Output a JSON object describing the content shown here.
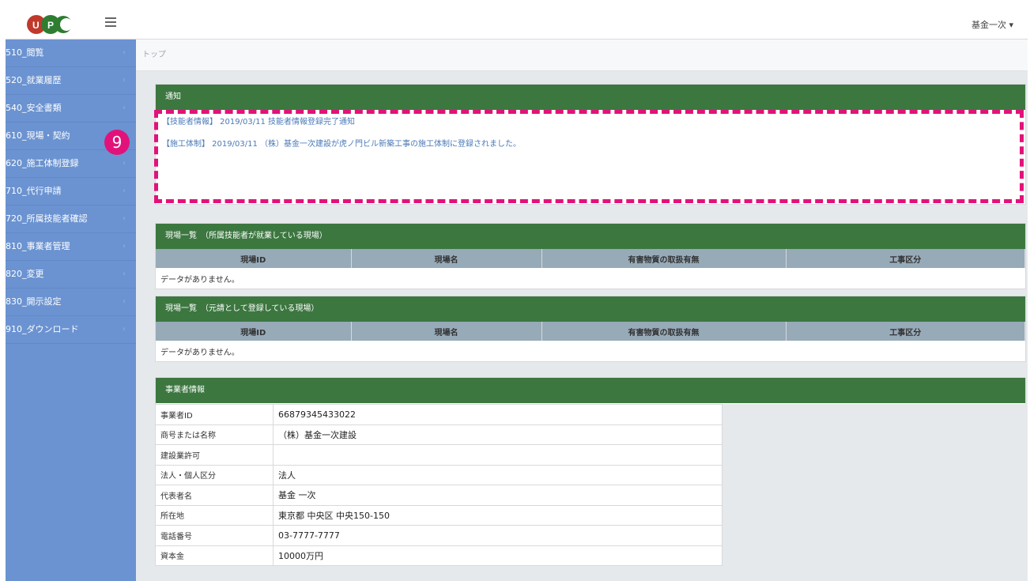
{
  "header": {
    "logo_text": "UCP",
    "user_menu": "基金一次 ▾"
  },
  "sidebar": {
    "items": [
      {
        "label": "510_閲覧"
      },
      {
        "label": "520_就業履歴"
      },
      {
        "label": "540_安全書類"
      },
      {
        "label": "610_現場・契約"
      },
      {
        "label": "620_施工体制登録"
      },
      {
        "label": "710_代行申請"
      },
      {
        "label": "720_所属技能者確認"
      },
      {
        "label": "810_事業者管理"
      },
      {
        "label": "820_変更"
      },
      {
        "label": "830_開示設定"
      },
      {
        "label": "910_ダウンロード"
      }
    ],
    "chevron": "‹"
  },
  "annotation": {
    "number": "9",
    "color": "#e2127a"
  },
  "breadcrumb": "トップ",
  "notice": {
    "title": "通知",
    "items": [
      "【技能者情報】 2019/03/11 技能者情報登録完了通知",
      "【施工体制】 2019/03/11 （株）基金一次建設が虎ノ門ビル新築工事の施工体制に登録されました。"
    ]
  },
  "sites_worked": {
    "title": "現場一覧　（所属技能者が就業している現場）",
    "columns": [
      "現場ID",
      "現場名",
      "有害物質の取扱有無",
      "工事区分"
    ],
    "empty": "データがありません。"
  },
  "sites_prime": {
    "title": "現場一覧　（元請として登録している現場）",
    "columns": [
      "現場ID",
      "現場名",
      "有害物質の取扱有無",
      "工事区分"
    ],
    "empty": "データがありません。"
  },
  "company": {
    "title": "事業者情報",
    "rows": [
      {
        "k": "事業者ID",
        "v": "66879345433022"
      },
      {
        "k": "商号または名称",
        "v": "（株）基金一次建設"
      },
      {
        "k": "建設業許可",
        "v": ""
      },
      {
        "k": "法人・個人区分",
        "v": "法人"
      },
      {
        "k": "代表者名",
        "v": "基金 一次"
      },
      {
        "k": "所在地",
        "v": "東京都 中央区 中央150-150"
      },
      {
        "k": "電話番号",
        "v": "03-7777-7777"
      },
      {
        "k": "資本金",
        "v": "10000万円"
      }
    ]
  },
  "colors": {
    "panel_header": "#3c7740",
    "sidebar": "#6b93d1",
    "table_header": "#97aab8",
    "link": "#4b79b8"
  }
}
